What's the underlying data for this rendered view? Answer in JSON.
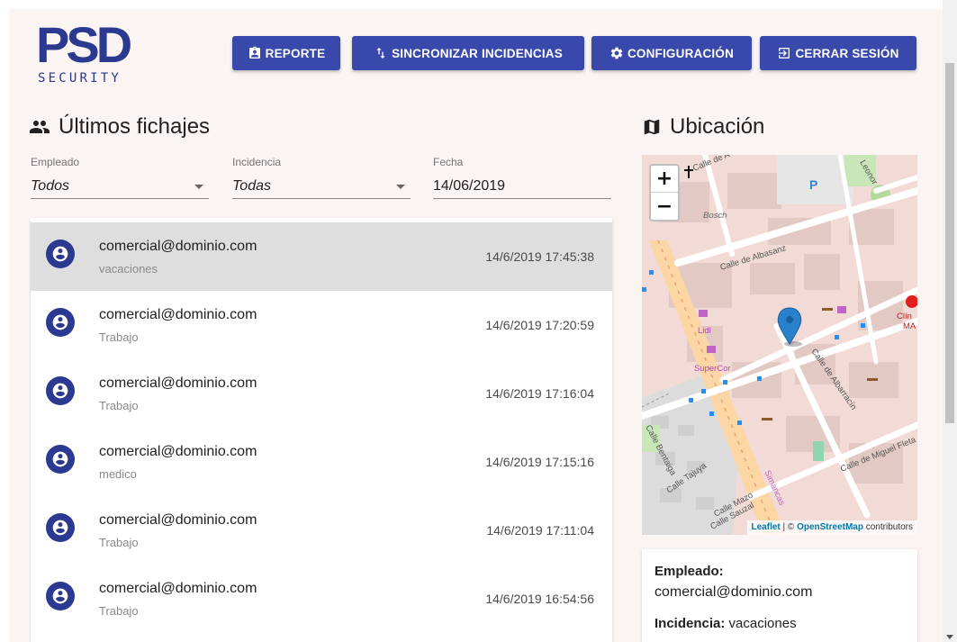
{
  "logo": {
    "main": "PSD",
    "sub": "SECURITY"
  },
  "toolbar": {
    "reporte": "REPORTE",
    "sincronizar": "SINCRONIZAR INCIDENCIAS",
    "configuracion": "CONFIGURACIÓN",
    "cerrar_sesion": "CERRAR SESIÓN"
  },
  "fichajes": {
    "title": "Últimos fichajes",
    "filters": {
      "empleado": {
        "label": "Empleado",
        "value": "Todos"
      },
      "incidencia": {
        "label": "Incidencia",
        "value": "Todas"
      },
      "fecha": {
        "label": "Fecha",
        "value": "14/06/2019"
      }
    },
    "items": [
      {
        "email": "comercial@dominio.com",
        "type": "vacaciones",
        "time": "14/6/2019 17:45:38",
        "selected": true
      },
      {
        "email": "comercial@dominio.com",
        "type": "Trabajo",
        "time": "14/6/2019 17:20:59"
      },
      {
        "email": "comercial@dominio.com",
        "type": "Trabajo",
        "time": "14/6/2019 17:16:04"
      },
      {
        "email": "comercial@dominio.com",
        "type": "medico",
        "time": "14/6/2019 17:15:16"
      },
      {
        "email": "comercial@dominio.com",
        "type": "Trabajo",
        "time": "14/6/2019 17:11:04"
      },
      {
        "email": "comercial@dominio.com",
        "type": "Trabajo",
        "time": "14/6/2019 16:54:56"
      }
    ]
  },
  "ubicacion": {
    "title": "Ubicación",
    "map": {
      "zoom_in": "+",
      "zoom_out": "−",
      "attribution": {
        "leaflet": "Leaflet",
        "sep": " | © ",
        "osm": "OpenStreetMap",
        "contributors": " contributors"
      },
      "labels": {
        "calle_albasanz": "Calle de Albasanz",
        "calle_albarracin": "Calle de Albarracín",
        "calle_miguel_fleta": "Calle de Miguel Fleta",
        "calle_bentaiga": "Calle Bentaiga",
        "calle_tajuya": "Calle Tajuya",
        "calle_mazo": "Calle Mazo",
        "calle_sauzal": "Calle Sauzal",
        "simancas": "Simancas",
        "bosch": "Bosch",
        "lidl": "Lidl",
        "supercor": "SuperCor",
        "parking": "P",
        "clinica": "Clín",
        "clinica_2": "MA",
        "calle_de_a": "Calle de A",
        "leonor": "Leonor"
      }
    },
    "info": {
      "empleado_label": "Empleado:",
      "empleado_value": "comercial@dominio.com",
      "incidencia_label": "Incidencia:",
      "incidencia_value": "vacaciones"
    }
  },
  "colors": {
    "primary": "#3949ab",
    "logo": "#2c3990",
    "background": "#faf4f3",
    "selected_row": "#dedede",
    "marker": "#2a81cb"
  }
}
